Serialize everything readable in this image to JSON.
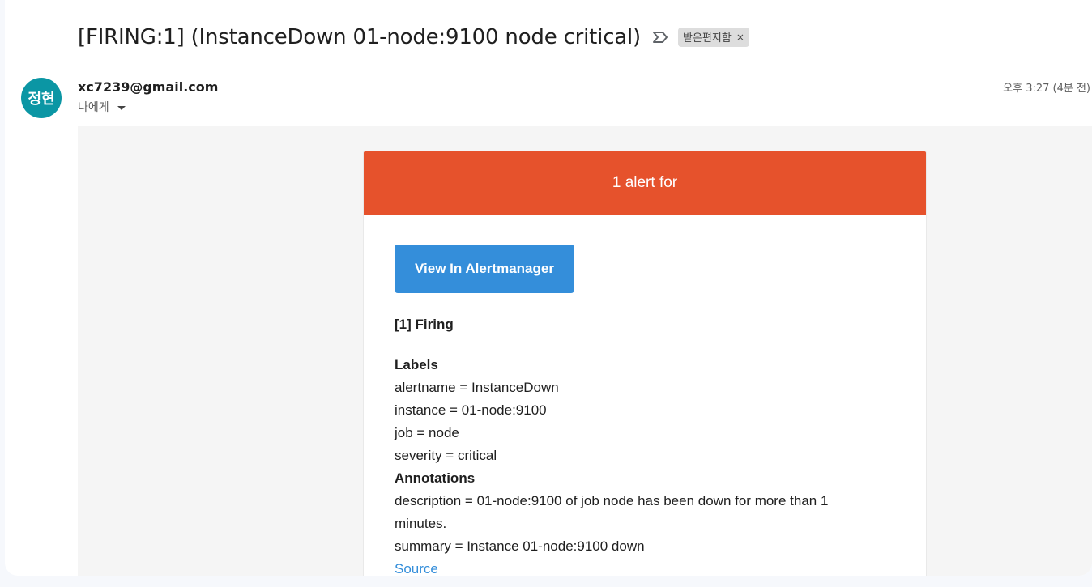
{
  "email": {
    "subject": "[FIRING:1] (InstanceDown 01-node:9100 node critical)",
    "label_chip": {
      "text": "받은편지함",
      "close": "×"
    },
    "avatar_text": "정현",
    "avatar_color": "#0b96a4",
    "sender": "xc7239@gmail.com",
    "recipient": "나에게",
    "time": "오후 3:27 (4분 전)"
  },
  "alert": {
    "header": "1 alert for",
    "header_color": "#e6522c",
    "button_label": "View In Alertmanager",
    "button_color": "#348eda",
    "firing_title": "[1] Firing",
    "labels_title": "Labels",
    "labels": [
      "alertname = InstanceDown",
      "instance = 01-node:9100",
      "job = node",
      "severity = critical"
    ],
    "annotations_title": "Annotations",
    "annotations": {
      "description": "description = 01-node:9100 of job node has been down for more than 1 minutes.",
      "summary": "summary = Instance 01-node:9100 down"
    },
    "source_label": "Source"
  },
  "icons": {
    "importance": "importance-marker-icon",
    "caret": "chevron-down-icon"
  }
}
